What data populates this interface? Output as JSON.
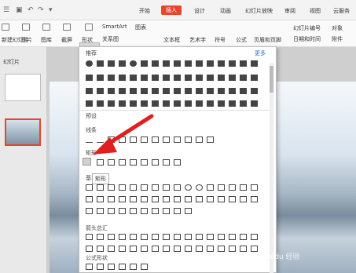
{
  "tabs": {
    "home": "开始",
    "insert": "插入",
    "design": "设计",
    "animation": "动画",
    "slideshow": "幻灯片放映",
    "review": "审阅",
    "view": "视图",
    "cloud": "云服务"
  },
  "ribbon": {
    "new_slide": "新建幻灯片",
    "image": "图片",
    "gallery": "图库",
    "screenshot": "截屏",
    "shapes": "形状",
    "smartart": "SmartArt",
    "chart": "图表",
    "relation": "关系图",
    "textbox": "文本框",
    "art_text": "艺术字",
    "symbol": "符号",
    "formula": "公式",
    "header_footer": "页眉和页脚",
    "slide_number": "幻灯片编号",
    "object": "对象",
    "datetime": "日期和时间",
    "attachment": "附件"
  },
  "panel": {
    "tab_label": "幻灯片"
  },
  "dropdown": {
    "recommended": "推荐",
    "more": "更多",
    "preset": "预设",
    "lines": "线条",
    "rectangle": "矩形",
    "basic": "基本形状",
    "block_arrows": "箭头总汇",
    "formula_shapes": "公式形状"
  },
  "tooltip": "矩形",
  "colors": {
    "accent": "#e9452a",
    "arrow": "#e02020",
    "selected": "#d0d0d0"
  },
  "watermark": "Baidu 经验"
}
